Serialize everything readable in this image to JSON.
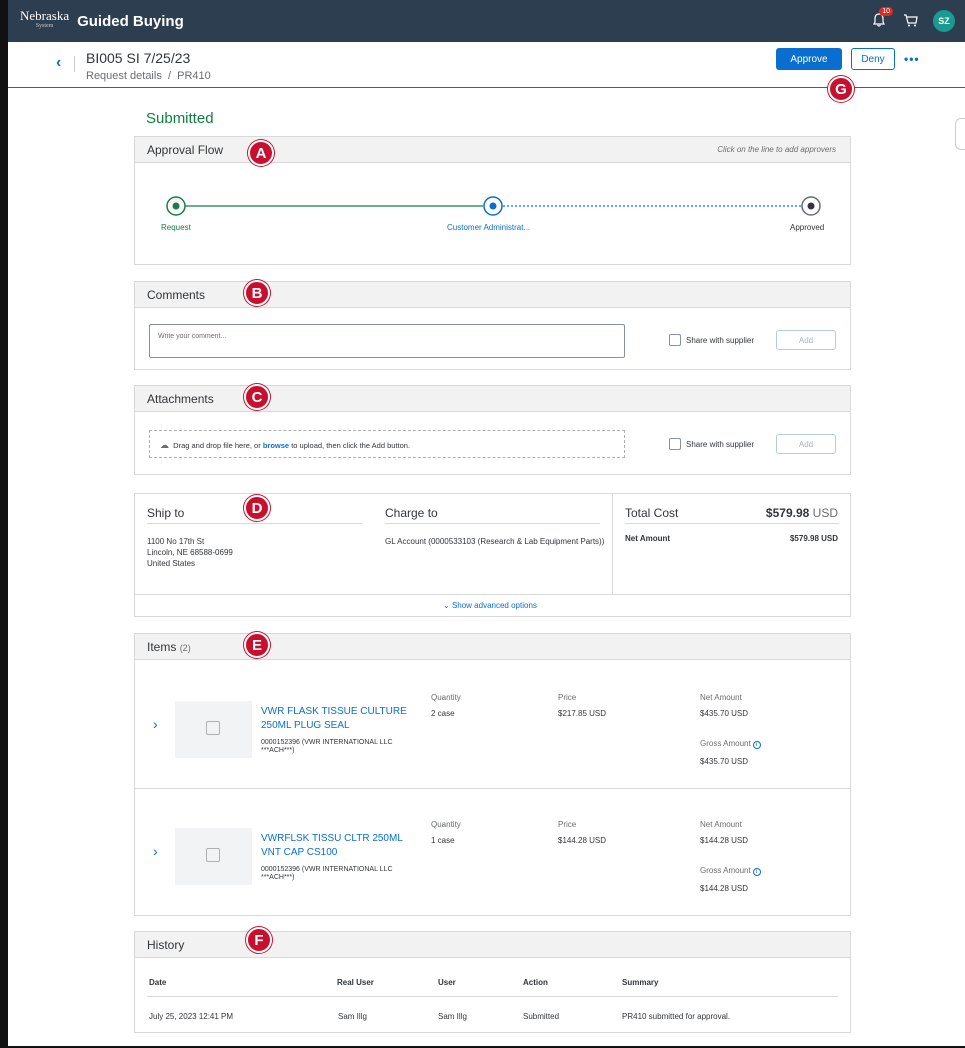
{
  "topbar": {
    "logo_text": "Nebraska",
    "logo_sub": "System",
    "app_title": "Guided Buying",
    "notification_count": "10",
    "avatar_initials": "SZ"
  },
  "header": {
    "title": "BI005 SI 7/25/23",
    "breadcrumb_root": "Request details",
    "breadcrumb_sep": "/",
    "breadcrumb_current": "PR410",
    "approve_label": "Approve",
    "deny_label": "Deny",
    "more_label": "•••"
  },
  "markers": {
    "a": "A",
    "b": "B",
    "c": "C",
    "d": "D",
    "e": "E",
    "f": "F",
    "g": "G"
  },
  "status": "Submitted",
  "approval_flow": {
    "title": "Approval Flow",
    "hint": "Click on the line to add approvers",
    "steps": [
      "Request",
      "Customer Administrat...",
      "Approved"
    ]
  },
  "comments": {
    "title": "Comments",
    "placeholder": "Write your comment...",
    "share_label": "Share with supplier",
    "add_label": "Add"
  },
  "attachments": {
    "title": "Attachments",
    "drop_text_1": "Drag and drop file here, or",
    "drop_link": "browse",
    "drop_text_2": "to upload, then click the Add button.",
    "share_label": "Share with supplier",
    "add_label": "Add"
  },
  "summary": {
    "ship_to_label": "Ship to",
    "ship_to_lines": [
      "1100 No 17th St",
      "Lincoln, NE  68588-0699",
      "United States"
    ],
    "charge_to_label": "Charge to",
    "charge_to_text": "GL Account (0000533103 (Research & Lab Equipment Parts))",
    "total_cost_label": "Total Cost",
    "total_cost_value": "$579.98",
    "total_cost_currency": "USD",
    "net_amount_label": "Net Amount",
    "net_amount_value": "$579.98 USD",
    "advanced_label": "Show advanced options"
  },
  "items": {
    "title": "Items",
    "count": "(2)",
    "rows": [
      {
        "name_line1": "VWR FLASK TISSUE CULTURE",
        "name_line2": "250ML PLUG SEAL",
        "supplier_line1": "0000152396 (VWR INTERNATIONAL LLC",
        "supplier_line2": "***ACH***)",
        "quantity_label": "Quantity",
        "quantity": "2  case",
        "price_label": "Price",
        "price": "$217.85  USD",
        "net_label": "Net Amount",
        "net": "$435.70  USD",
        "gross_label": "Gross Amount",
        "gross": "$435.70  USD"
      },
      {
        "name_line1": "VWRFLSK TISSU CLTR 250ML",
        "name_line2": "VNT CAP CS100",
        "supplier_line1": "0000152396 (VWR INTERNATIONAL LLC",
        "supplier_line2": "***ACH***)",
        "quantity_label": "Quantity",
        "quantity": "1  case",
        "price_label": "Price",
        "price": "$144.28  USD",
        "net_label": "Net Amount",
        "net": "$144.28  USD",
        "gross_label": "Gross Amount",
        "gross": "$144.28  USD"
      }
    ]
  },
  "history": {
    "title": "History",
    "columns": [
      "Date",
      "Real User",
      "User",
      "Action",
      "Summary"
    ],
    "rows": [
      [
        "July 25, 2023 12:41 PM",
        "Sam Illg",
        "Sam Illg",
        "Submitted",
        "PR410 submitted for approval."
      ]
    ]
  },
  "colors": {
    "topbar": "#2c3e50",
    "accent": "#0a6ed1",
    "success": "#107e3e",
    "marker": "#c8102e"
  }
}
